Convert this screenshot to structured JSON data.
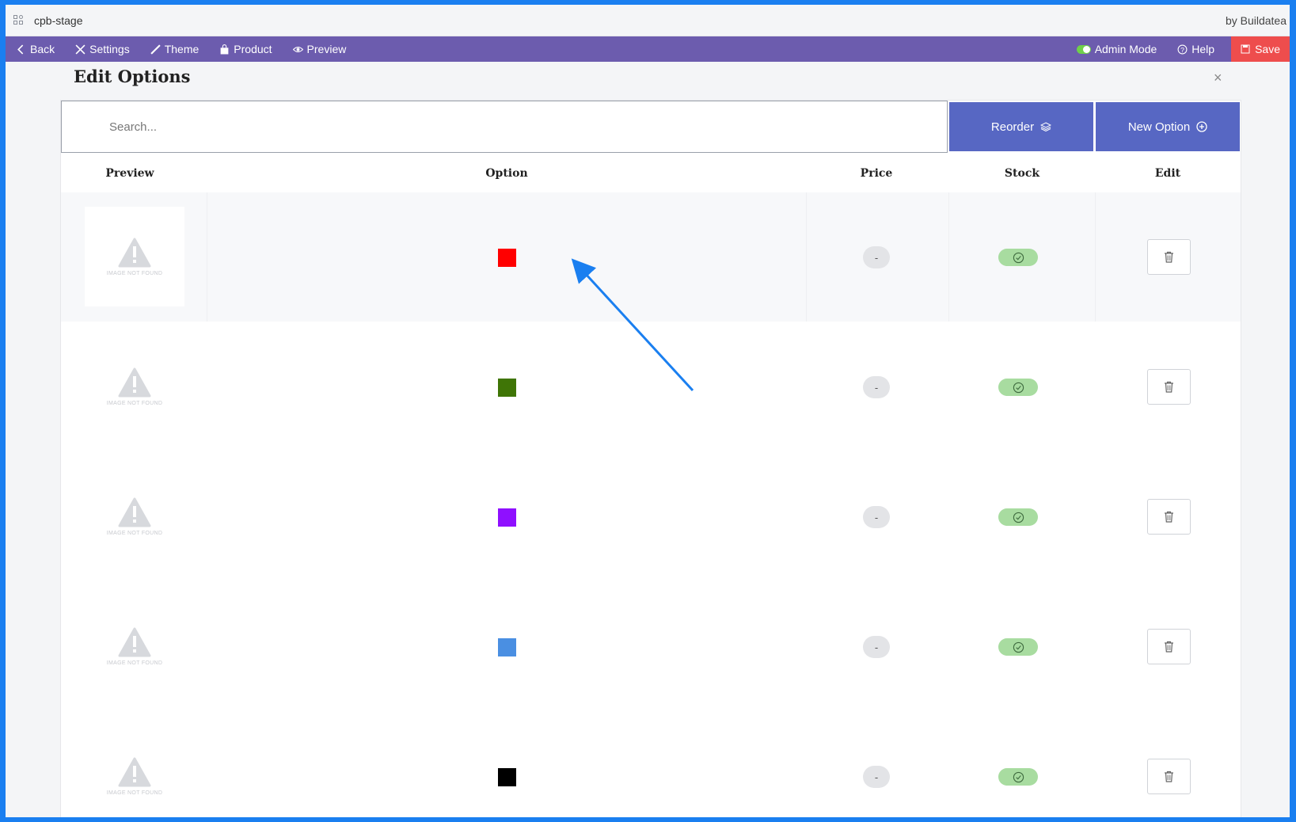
{
  "window": {
    "title": "cpb-stage",
    "byline": "by Buildatea"
  },
  "toolbar": {
    "back": "Back",
    "settings": "Settings",
    "theme": "Theme",
    "product": "Product",
    "preview": "Preview",
    "admin_mode": "Admin Mode",
    "help": "Help",
    "save": "Save"
  },
  "modal": {
    "title": "Edit Options",
    "close": "×",
    "search_placeholder": "Search...",
    "reorder_label": "Reorder",
    "new_option_label": "New Option"
  },
  "table": {
    "headers": {
      "preview": "Preview",
      "option": "Option",
      "price": "Price",
      "stock": "Stock",
      "edit": "Edit"
    },
    "image_not_found": "IMAGE NOT FOUND",
    "rows": [
      {
        "color": "#ff0000",
        "price": "-",
        "in_stock": true
      },
      {
        "color": "#3f7506",
        "price": "-",
        "in_stock": true
      },
      {
        "color": "#8f10ff",
        "price": "-",
        "in_stock": true
      },
      {
        "color": "#4a8fe2",
        "price": "-",
        "in_stock": true
      },
      {
        "color": "#000000",
        "price": "-",
        "in_stock": true
      }
    ]
  },
  "colors": {
    "toolbar": "#6c5cae",
    "button": "#5767c3",
    "save": "#ee4d4d",
    "frame": "#1a7ff0",
    "annotation_arrow": "#1a7ff0"
  }
}
